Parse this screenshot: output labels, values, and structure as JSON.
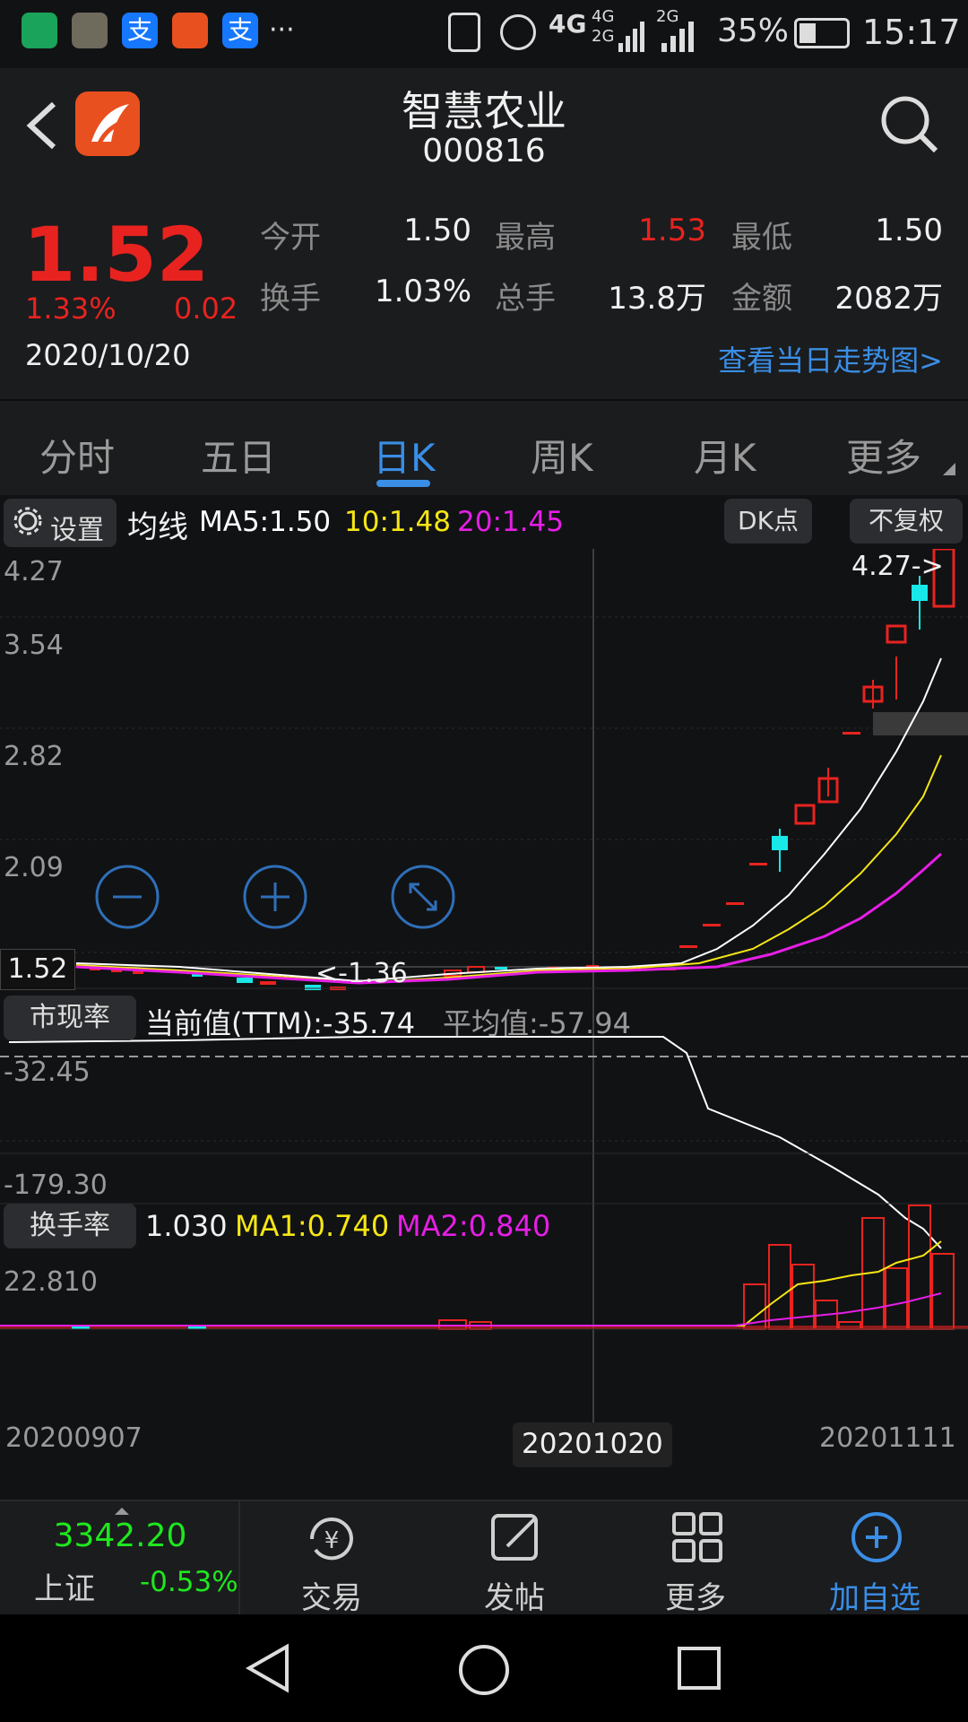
{
  "status_bar": {
    "network": "4G",
    "network2": "4G",
    "network3": "2G",
    "network4": "2G",
    "battery": "35%",
    "time": "15:17",
    "more_dots": "···"
  },
  "header": {
    "title": "智慧农业",
    "code": "000816"
  },
  "quote": {
    "price": "1.52",
    "change_pct": "1.33%",
    "change_abs": "0.02",
    "date": "2020/10/20",
    "fields": {
      "open_label": "今开",
      "open_value": "1.50",
      "high_label": "最高",
      "high_value": "1.53",
      "low_label": "最低",
      "low_value": "1.50",
      "turnover_label": "换手",
      "turnover_value": "1.03%",
      "volume_label": "总手",
      "volume_value": "13.8万",
      "amount_label": "金额",
      "amount_value": "2082万"
    },
    "intraday_link": "查看当日走势图>"
  },
  "tabs": [
    {
      "label": "分时"
    },
    {
      "label": "五日"
    },
    {
      "label": "日K"
    },
    {
      "label": "周K"
    },
    {
      "label": "月K"
    },
    {
      "label": "更多"
    }
  ],
  "chart_toolbar": {
    "settings_label": "设置",
    "ma_title": "均线",
    "ma5": "MA5:1.50",
    "ma10": "10:1.48",
    "ma20": "20:1.45",
    "dk_button": "DK点",
    "adjust_button": "不复权"
  },
  "main_chart": {
    "y_labels": [
      "4.27",
      "3.54",
      "2.82",
      "2.09"
    ],
    "current_price_tag": "1.52",
    "max_marker": "4.27->",
    "min_marker": "<-1.36"
  },
  "indicator": {
    "label": "市现率",
    "current": "当前值(TTM):-35.74",
    "average": "平均值:-57.94",
    "y_top": "-32.45",
    "y_bottom": "-179.30"
  },
  "turnover_panel": {
    "label": "换手率",
    "value": "1.030",
    "ma1": "MA1:0.740",
    "ma2": "MA2:0.840",
    "y_max": "22.810",
    "x_start": "20200907",
    "x_cursor": "20201020",
    "x_end": "20201111"
  },
  "colors": {
    "up": "#e8231f",
    "down": "#18e8e8",
    "ma5": "#ffffff",
    "ma10": "#f5e614",
    "ma20": "#e61ee6",
    "accent": "#3a8ee6"
  },
  "bottom_nav": {
    "index_value": "3342.20",
    "index_name": "上证",
    "index_change": "-0.53%",
    "trade": "交易",
    "post": "发帖",
    "more": "更多",
    "add_watch": "加自选"
  },
  "chart_data": {
    "type": "candlestick",
    "x_start": "20200907",
    "x_cursor": "20201020",
    "x_end": "20201111",
    "ylim": [
      1.36,
      4.27
    ],
    "recent_closes_approx": [
      1.52,
      1.74,
      1.86,
      2.09,
      2.3,
      2.58,
      2.7,
      3.0,
      3.2,
      3.54,
      3.94,
      4.27
    ]
  }
}
